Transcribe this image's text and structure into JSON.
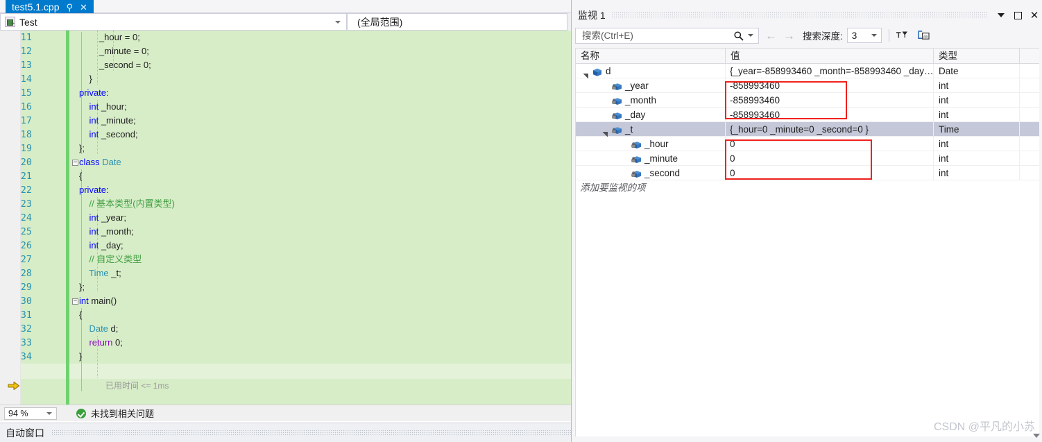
{
  "editor": {
    "tab": {
      "title": "test5.1.cpp",
      "pin_icon": "pin-icon",
      "close_icon": "close-icon"
    },
    "nav": {
      "class_scope": "Test",
      "member_scope": "(全局范围)"
    },
    "code_lines": [
      {
        "num": "11",
        "text": "            _hour = 0;"
      },
      {
        "num": "12",
        "text": "            _minute = 0;"
      },
      {
        "num": "13",
        "text": "            _second = 0;"
      },
      {
        "num": "14",
        "text": "        }"
      },
      {
        "num": "15",
        "text": "    private:"
      },
      {
        "num": "16",
        "text": "        int _hour;"
      },
      {
        "num": "17",
        "text": "        int _minute;"
      },
      {
        "num": "18",
        "text": "        int _second;"
      },
      {
        "num": "19",
        "text": "    };"
      },
      {
        "num": "20",
        "text": "    class Date"
      },
      {
        "num": "21",
        "text": "    {"
      },
      {
        "num": "22",
        "text": "    private:"
      },
      {
        "num": "23",
        "text": "        // 基本类型(内置类型)"
      },
      {
        "num": "24",
        "text": "        int _year;"
      },
      {
        "num": "25",
        "text": "        int _month;"
      },
      {
        "num": "26",
        "text": "        int _day;"
      },
      {
        "num": "27",
        "text": "        // 自定义类型"
      },
      {
        "num": "28",
        "text": "        Time _t;"
      },
      {
        "num": "29",
        "text": "    };"
      },
      {
        "num": "30",
        "text": "    int main()"
      },
      {
        "num": "31",
        "text": "    {"
      },
      {
        "num": "32",
        "text": "        Date d;"
      },
      {
        "num": "33",
        "text": "        return 0;"
      },
      {
        "num": "34",
        "text": "    }"
      }
    ],
    "elapsed_annotation": "已用时间 <= 1ms",
    "status": {
      "zoom": "94 %",
      "issue_icon": "check-circle-icon",
      "issue_text": "未找到相关问题"
    }
  },
  "autos": {
    "title": "自动窗口"
  },
  "watch": {
    "title": "监视 1",
    "titlebar_icons": {
      "dropdown": "chevron-down-icon",
      "maximize": "maximize-icon",
      "close": "close-icon"
    },
    "toolbar": {
      "search_placeholder": "搜索(Ctrl+E)",
      "search_value": "",
      "search_icon": "search-icon",
      "prev_icon": "arrow-left-icon",
      "next_icon": "arrow-right-icon",
      "depth_label": "搜索深度:",
      "depth_value": "3",
      "pin_filter_icon": "pin-filter-icon",
      "hex_display_icon": "hex-display-icon"
    },
    "columns": {
      "name": "名称",
      "value": "值",
      "type": "类型"
    },
    "rows": [
      {
        "indent": 0,
        "expander": "expanded",
        "icon": "object-box-icon",
        "name": "d",
        "value": "{_year=-858993460 _month=-858993460 _day…",
        "type": "Date",
        "selected": false
      },
      {
        "indent": 1,
        "expander": "none",
        "icon": "private-field-icon",
        "name": "_year",
        "value": "-858993460",
        "type": "int",
        "selected": false
      },
      {
        "indent": 1,
        "expander": "none",
        "icon": "private-field-icon",
        "name": "_month",
        "value": "-858993460",
        "type": "int",
        "selected": false
      },
      {
        "indent": 1,
        "expander": "none",
        "icon": "private-field-icon",
        "name": "_day",
        "value": "-858993460",
        "type": "int",
        "selected": false
      },
      {
        "indent": 1,
        "expander": "expanded",
        "icon": "private-field-icon",
        "name": "_t",
        "value": "{_hour=0 _minute=0 _second=0 }",
        "type": "Time",
        "selected": true
      },
      {
        "indent": 2,
        "expander": "none",
        "icon": "private-field-icon",
        "name": "_hour",
        "value": "0",
        "type": "int",
        "selected": false
      },
      {
        "indent": 2,
        "expander": "none",
        "icon": "private-field-icon",
        "name": "_minute",
        "value": "0",
        "type": "int",
        "selected": false
      },
      {
        "indent": 2,
        "expander": "none",
        "icon": "private-field-icon",
        "name": "_second",
        "value": "0",
        "type": "int",
        "selected": false
      }
    ],
    "add_watch_placeholder": "添加要监视的项"
  },
  "watermark": "CSDN @平凡的小苏",
  "colors": {
    "tab_active": "#007acc",
    "code_bg": "#d7edc8",
    "keyword": "#0000ff",
    "type": "#2b91af",
    "comment": "#3f9c3f",
    "return_keyword": "#8f08c4",
    "line_number": "#2b91af",
    "change_bar": "#6fd16f",
    "highlight_box": "#f1211c",
    "row_selected": "#c5c8d8",
    "ok_green": "#3aa03a"
  }
}
